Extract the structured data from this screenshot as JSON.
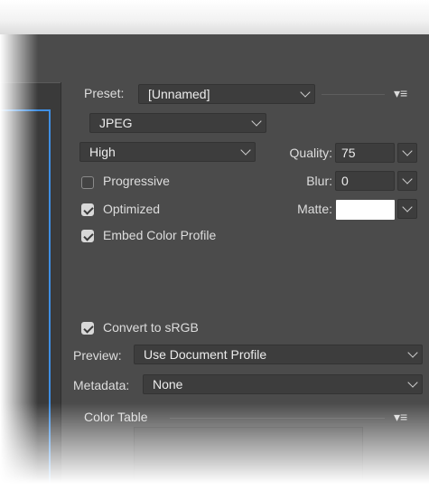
{
  "preset": {
    "label": "Preset:",
    "value": "[Unnamed]"
  },
  "format": {
    "value": "JPEG"
  },
  "quality_level": {
    "value": "High"
  },
  "quality": {
    "label": "Quality:",
    "value": "75"
  },
  "blur": {
    "label": "Blur:",
    "value": "0"
  },
  "matte": {
    "label": "Matte:",
    "color": "#ffffff"
  },
  "options": {
    "progressive": {
      "label": "Progressive",
      "checked": false
    },
    "optimized": {
      "label": "Optimized",
      "checked": true
    },
    "embed_profile": {
      "label": "Embed Color Profile",
      "checked": true
    },
    "convert_srgb": {
      "label": "Convert to sRGB",
      "checked": true
    }
  },
  "preview": {
    "label": "Preview:",
    "value": "Use Document Profile"
  },
  "metadata": {
    "label": "Metadata:",
    "value": "None"
  },
  "color_table": {
    "label": "Color Table"
  },
  "icons": {
    "panel_menu": "panel-menu-icon",
    "dropdown": "chevron-down-icon"
  },
  "colors": {
    "panel_bg": "#4b4b4b",
    "field_bg": "#3d3d3d",
    "accent_blue": "#3f8fe3"
  }
}
